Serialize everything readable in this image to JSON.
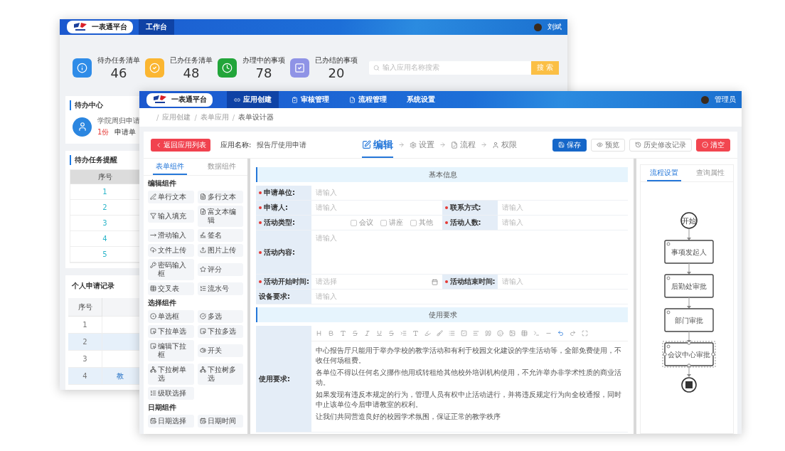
{
  "back_window": {
    "logo": "一表通平台",
    "nav": [
      {
        "label": "工作台",
        "selected": true
      }
    ],
    "user": "刘斌",
    "stats": [
      {
        "label": "待办任务清单",
        "value": "46",
        "color": "#2f8ce8",
        "kind": "info"
      },
      {
        "label": "已办任务清单",
        "value": "48",
        "color": "#fbb631",
        "kind": "check"
      },
      {
        "label": "办理中的事项",
        "value": "78",
        "color": "#22a53a",
        "kind": "clock"
      },
      {
        "label": "已办结的事项",
        "value": "20",
        "color": "#8f93e6",
        "kind": "square"
      }
    ],
    "search": {
      "placeholder": "输入应用名称搜索",
      "button": "搜 索"
    },
    "todo_center": {
      "title": "待办中心",
      "item_title": "学院周归申请",
      "count": "1份",
      "type": "申请单"
    },
    "reminders": {
      "title": "待办任务提醒",
      "columns": [
        "序号"
      ],
      "rows": [
        "1",
        "2",
        "3",
        "4",
        "5"
      ]
    },
    "records": {
      "title": "个人申请记录",
      "columns": [
        "序号"
      ],
      "rows": [
        {
          "no": "1"
        },
        {
          "no": "2"
        },
        {
          "no": "3"
        },
        {
          "no": "4",
          "column_2": "教"
        }
      ]
    }
  },
  "front_window": {
    "logo": "一表通平台",
    "nav": [
      {
        "label": "应用创建",
        "selected": true,
        "kind": "link"
      },
      {
        "label": "审核管理",
        "selected": false,
        "kind": "audit"
      },
      {
        "label": "流程管理",
        "selected": false,
        "kind": "flow"
      },
      {
        "label": "系统设置",
        "selected": false,
        "kind": "none"
      }
    ],
    "user": "管理员",
    "breadcrumb_separator": "/",
    "breadcrumb": [
      "应用创建",
      "表单应用",
      "表单设计器"
    ],
    "back_button": "返回应用列表",
    "app_name": {
      "label": "应用名称:",
      "value": "报告厅使用申请"
    },
    "steps": [
      {
        "label": "编辑",
        "selected": true,
        "kind": "edit"
      },
      {
        "label": "设置",
        "selected": false,
        "kind": "gear"
      },
      {
        "label": "流程",
        "selected": false,
        "kind": "flow"
      },
      {
        "label": "权限",
        "selected": false,
        "kind": "user"
      }
    ],
    "actions": [
      {
        "label": "保存",
        "kind": "primary"
      },
      {
        "label": "预览",
        "kind": "preview"
      },
      {
        "label": "历史修改记录",
        "kind": "history"
      },
      {
        "label": "清空",
        "kind": "danger"
      }
    ],
    "palette": {
      "tabs": [
        {
          "label": "表单组件",
          "selected": true
        },
        {
          "label": "数据组件",
          "selected": false
        }
      ],
      "groups": [
        {
          "title": "编辑组件",
          "items": [
            {
              "label": "单行文本",
              "kind": "pen"
            },
            {
              "label": "多行文本",
              "kind": "textarea"
            },
            {
              "label": "输入填充",
              "kind": "filter"
            },
            {
              "label": "富文本编辑",
              "kind": "doc"
            },
            {
              "label": "滑动输入",
              "kind": "slide"
            },
            {
              "label": "签名",
              "kind": "sign"
            },
            {
              "label": "文件上传",
              "kind": "cloud"
            },
            {
              "label": "图片上传",
              "kind": "upload"
            },
            {
              "label": "密码输入框",
              "kind": "key"
            },
            {
              "label": "评分",
              "kind": "star"
            },
            {
              "label": "交叉表",
              "kind": "table"
            },
            {
              "label": "流水号",
              "kind": "list"
            }
          ]
        },
        {
          "title": "选择组件",
          "items": [
            {
              "label": "单选框",
              "kind": "radio"
            },
            {
              "label": "多选",
              "kind": "check"
            },
            {
              "label": "下拉单选",
              "kind": "select"
            },
            {
              "label": "下拉多选",
              "kind": "select"
            },
            {
              "label": "编辑下拉框",
              "kind": "select"
            },
            {
              "label": "开关",
              "kind": "switch"
            },
            {
              "label": "下拉树单选",
              "kind": "tree"
            },
            {
              "label": "下拉树多选",
              "kind": "tree"
            },
            {
              "label": "级联选择",
              "kind": "list"
            }
          ]
        },
        {
          "title": "日期组件",
          "items": [
            {
              "label": "日期选择",
              "kind": "clock"
            },
            {
              "label": "日期时间",
              "kind": "clock"
            }
          ]
        }
      ]
    },
    "form": {
      "sections": [
        {
          "title": "基本信息",
          "rows": [
            [
              {
                "label": "申请单位:",
                "required": true,
                "kind": "text",
                "placeholder": "请输入"
              }
            ],
            [
              {
                "label": "申请人:",
                "required": true,
                "kind": "text",
                "placeholder": "请输入"
              },
              {
                "label": "联系方式:",
                "required": true,
                "kind": "text",
                "placeholder": "请输入"
              }
            ],
            [
              {
                "label": "活动类型:",
                "required": true,
                "kind": "checkbox",
                "options": [
                  {
                    "label": "会议",
                    "checked": false
                  },
                  {
                    "label": "讲座",
                    "checked": false
                  },
                  {
                    "label": "其他",
                    "checked": false
                  }
                ]
              },
              {
                "label": "活动人数:",
                "required": true,
                "kind": "text",
                "placeholder": "请输入"
              }
            ],
            [
              {
                "label": "活动内容:",
                "required": true,
                "kind": "textarea",
                "placeholder": "请输入"
              }
            ],
            [
              {
                "label": "活动开始时间:",
                "required": true,
                "kind": "date",
                "placeholder": "请选择"
              },
              {
                "label": "活动结束时间:",
                "required": true,
                "kind": "text",
                "placeholder": "请输入"
              }
            ],
            [
              {
                "label": "设备要求:",
                "required": false,
                "kind": "text",
                "placeholder": "请输入"
              }
            ]
          ]
        },
        {
          "title": "使用要求",
          "rows": [
            [
              {
                "label": "使用要求:",
                "required": false,
                "kind": "richtext",
                "paragraphs": [
                  "中心报告厅只能用于举办学校的教学活动和有利于校园文化建设的学生活动等，全部免费使用，不收任何场租费。",
                  "各单位不得以任何名义挪作他用或转租给其他校外培训机构使用，不允许举办非学术性质的商业活动。",
                  "如果发现有违反本规定的行为，管理人员有权中止活动进行，并将违反规定行为向全校通报，同时中止该单位今后申请教室的权利。",
                  "让我们共同营造良好的校园学术氛围，保证正常的教学秩序"
                ]
              }
            ]
          ]
        }
      ]
    },
    "flow_panel": {
      "tabs": [
        {
          "label": "流程设置",
          "selected": true
        },
        {
          "label": "查询属性",
          "selected": false
        }
      ],
      "nodes": [
        {
          "kind": "start",
          "label": "开始",
          "selected": false
        },
        {
          "kind": "task",
          "label": "事项发起人",
          "selected": false
        },
        {
          "kind": "task",
          "label": "后勤处审批",
          "selected": false
        },
        {
          "kind": "task",
          "label": "部门审批",
          "selected": false
        },
        {
          "kind": "task",
          "label": "会议中心审批",
          "selected": true
        },
        {
          "kind": "end",
          "selected": false
        }
      ]
    }
  }
}
